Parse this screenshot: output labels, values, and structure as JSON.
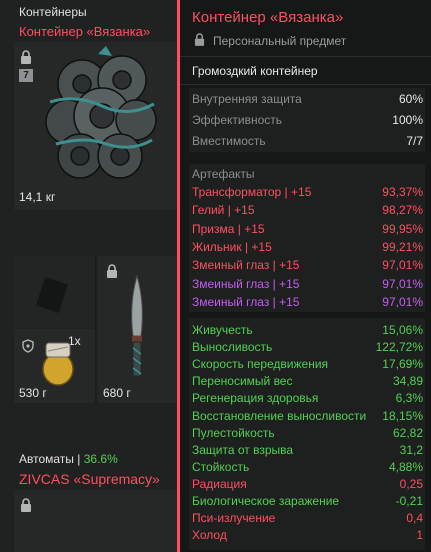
{
  "inventory": {
    "section_containers": "Контейнеры",
    "container_name": "Контейнер «Вязанка»",
    "container_badge": "7",
    "container_weight": "14,1 кг",
    "item_grenade_qty": "1x",
    "item_grenade_weight": "530 г",
    "item_knife_weight": "680 г",
    "section_rifles_label": "Автоматы | ",
    "section_rifles_percent": "36.6%",
    "rifle_name": "ZIVCAS «Supremacy»"
  },
  "tooltip": {
    "title": "Контейнер «Вязанка»",
    "subtitle": "Персональный предмет",
    "type": "Громоздкий контейнер",
    "stats": [
      {
        "label": "Внутренняя защита",
        "value": "60%"
      },
      {
        "label": "Эффективность",
        "value": "100%"
      },
      {
        "label": "Вместимость",
        "value": "7/7"
      }
    ],
    "artifacts_header": "Артефакты",
    "artifacts": [
      {
        "label": "Трансформатор | +15",
        "value": "93,37%",
        "color": "#ff4e60"
      },
      {
        "label": "Гелий | +15",
        "value": "98,27%",
        "color": "#ff4e60"
      },
      {
        "label": "Призма | +15",
        "value": "99,95%",
        "color": "#ff4e60"
      },
      {
        "label": "Жильник | +15",
        "value": "99,21%",
        "color": "#ff4e60"
      },
      {
        "label": "Змеиный глаз | +15",
        "value": "97,01%",
        "color": "#ff4e60"
      },
      {
        "label": "Змеиный глаз | +15",
        "value": "97,01%",
        "color": "#c65cf0"
      },
      {
        "label": "Змеиный глаз | +15",
        "value": "97,01%",
        "color": "#c65cf0"
      }
    ],
    "effects": [
      {
        "label": "Живучесть",
        "value": "15,06%",
        "color": "#52d052"
      },
      {
        "label": "Выносливость",
        "value": "122,72%",
        "color": "#52d052"
      },
      {
        "label": "Скорость передвижения",
        "value": "17,69%",
        "color": "#52d052"
      },
      {
        "label": "Переносимый вес",
        "value": "34,89",
        "color": "#52d052"
      },
      {
        "label": "Регенерация здоровья",
        "value": "6,3%",
        "color": "#52d052"
      },
      {
        "label": "Восстановление выносливости",
        "value": "18,15%",
        "color": "#52d052"
      },
      {
        "label": "Пулестойкость",
        "value": "62,82",
        "color": "#52d052"
      },
      {
        "label": "Защита от взрыва",
        "value": "31,2",
        "color": "#52d052"
      },
      {
        "label": "Стойкость",
        "value": "4,88%",
        "color": "#52d052"
      },
      {
        "label": "Радиация",
        "value": "0,25",
        "color": "#ff4e60"
      },
      {
        "label": "Биологическое заражение",
        "value": "-0,21",
        "color": "#52d052"
      },
      {
        "label": "Пси-излучение",
        "value": "0,4",
        "color": "#ff4e60"
      },
      {
        "label": "Холод",
        "value": "1",
        "color": "#ff4e60"
      }
    ]
  },
  "colors": {
    "accent_red": "#ff4e60",
    "positive_green": "#52d052",
    "artifact_purple": "#c65cf0",
    "stat_grey": "#8c8e8e"
  }
}
